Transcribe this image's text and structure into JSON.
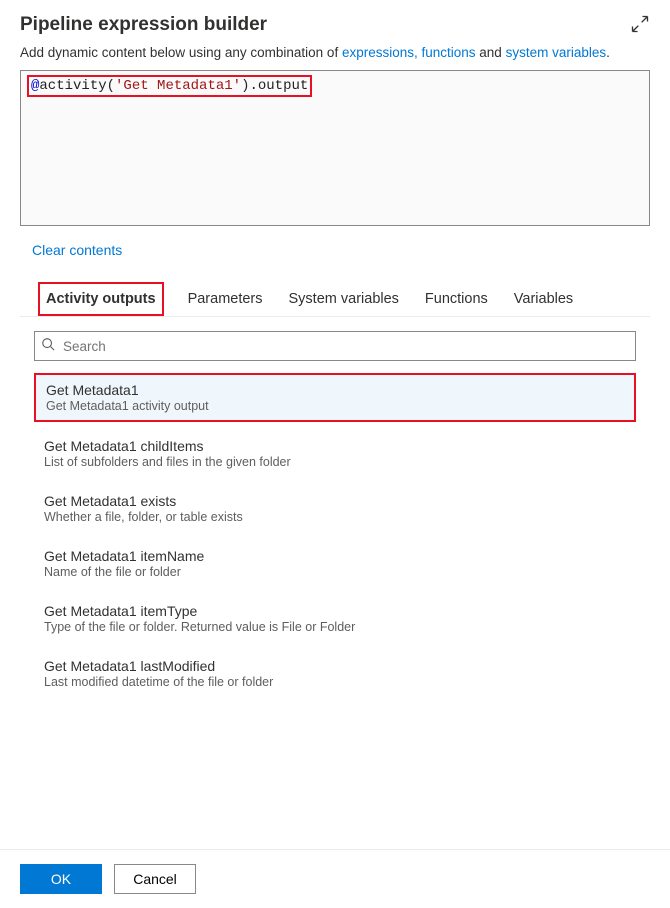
{
  "header": {
    "title": "Pipeline expression builder"
  },
  "subtitle": {
    "prefix": "Add dynamic content below using any combination of ",
    "link1": "expressions, functions",
    "mid": " and ",
    "link2": "system variables",
    "suffix": "."
  },
  "editor": {
    "at": "@",
    "fn": "activity(",
    "str": "'Get Metadata1'",
    "close": ")",
    "dot": ".",
    "out": "output"
  },
  "actions": {
    "clear": "Clear contents"
  },
  "tabs": {
    "t0": "Activity outputs",
    "t1": "Parameters",
    "t2": "System variables",
    "t3": "Functions",
    "t4": "Variables"
  },
  "search": {
    "placeholder": "Search"
  },
  "items": [
    {
      "title": "Get Metadata1",
      "desc": "Get Metadata1 activity output"
    },
    {
      "title": "Get Metadata1 childItems",
      "desc": "List of subfolders and files in the given folder"
    },
    {
      "title": "Get Metadata1 exists",
      "desc": "Whether a file, folder, or table exists"
    },
    {
      "title": "Get Metadata1 itemName",
      "desc": "Name of the file or folder"
    },
    {
      "title": "Get Metadata1 itemType",
      "desc": "Type of the file or folder. Returned value is File or Folder"
    },
    {
      "title": "Get Metadata1 lastModified",
      "desc": "Last modified datetime of the file or folder"
    }
  ],
  "footer": {
    "ok": "OK",
    "cancel": "Cancel"
  }
}
